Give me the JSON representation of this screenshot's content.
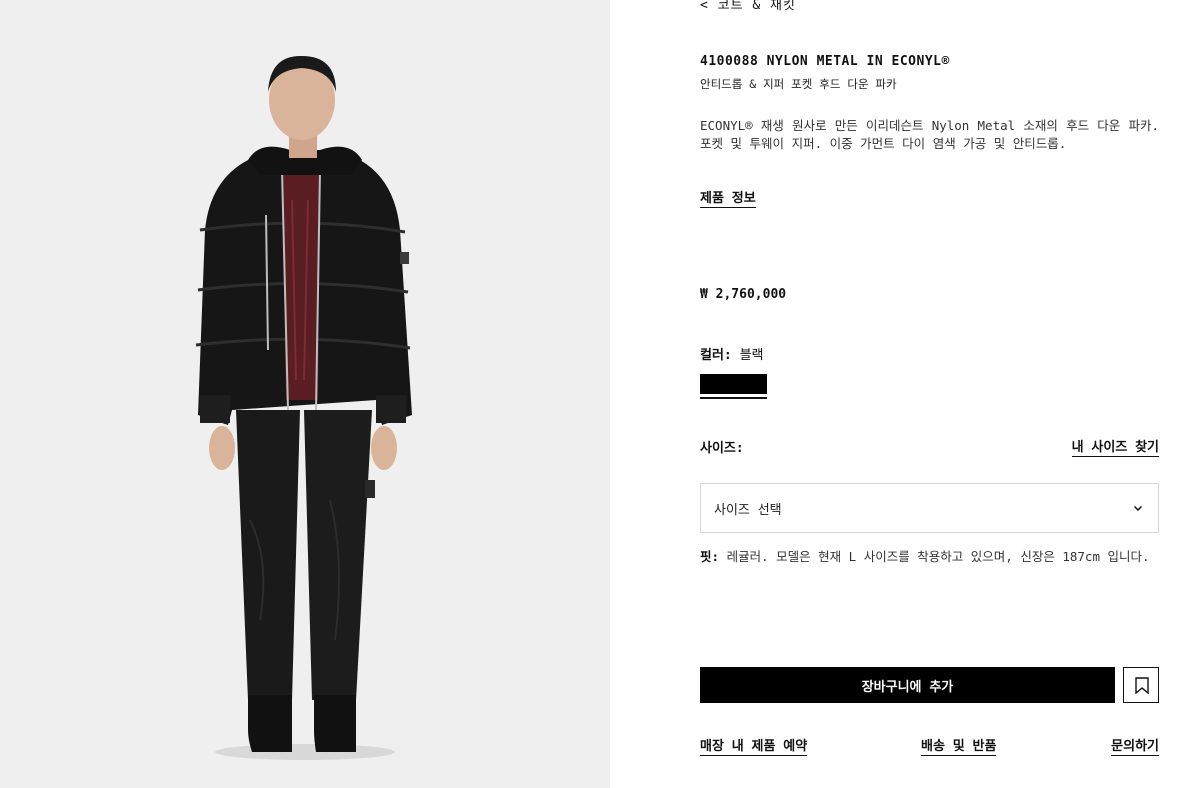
{
  "breadcrumb": {
    "back_label": "< 코트 & 재킷"
  },
  "product": {
    "title": "4100088 NYLON METAL IN ECONYL®",
    "subtitle": "안티드롭 & 지퍼 포켓 후드 다운 파카",
    "description": "ECONYL® 재생 원사로 만든 이리데슨트 Nylon Metal 소재의 후드 다운 파카. 포켓 및 투웨이 지퍼. 이중 가먼트 다이 염색 가공 및 안티드롭.",
    "info_link": "제품 정보",
    "price": "₩ 2,760,000"
  },
  "color": {
    "label": "컬러:",
    "value": "블랙",
    "swatch_hex": "#000000"
  },
  "size": {
    "label": "사이즈:",
    "guide_link": "내 사이즈 찾기",
    "select_placeholder": "사이즈 선택"
  },
  "fit": {
    "label": "핏:",
    "text": "레귤러. 모델은 현재 L 사이즈를 착용하고 있으며, 신장은 187cm 입니다."
  },
  "actions": {
    "add_to_bag": "장바구니에 추가",
    "wishlist_icon": "bookmark-icon"
  },
  "footer_links": {
    "store_reserve": "매장 내 제품 예약",
    "shipping": "배송 및 반품",
    "contact": "문의하기"
  }
}
